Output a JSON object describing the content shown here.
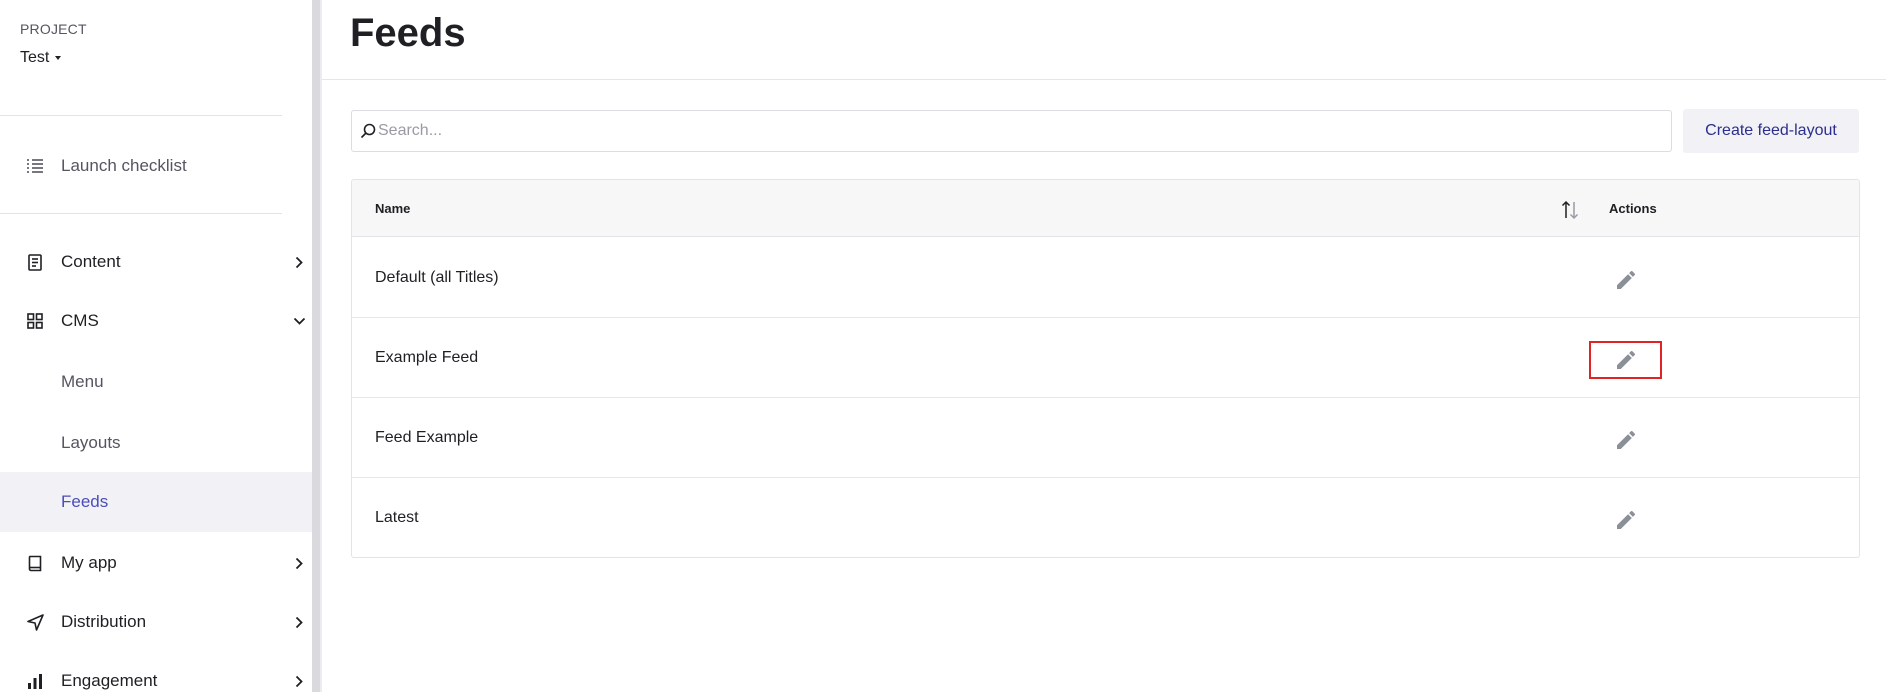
{
  "sidebar": {
    "project_label": "PROJECT",
    "project_name": "Test",
    "items": [
      {
        "label": "Launch checklist",
        "icon": "checklist-icon"
      },
      {
        "label": "Content",
        "icon": "document-icon"
      },
      {
        "label": "CMS",
        "icon": "grid-icon"
      },
      {
        "label": "Menu"
      },
      {
        "label": "Layouts"
      },
      {
        "label": "Feeds",
        "active": true
      },
      {
        "label": "My app",
        "icon": "book-icon"
      },
      {
        "label": "Distribution",
        "icon": "send-icon"
      },
      {
        "label": "Engagement",
        "icon": "bar-chart-icon"
      }
    ]
  },
  "main": {
    "title": "Feeds",
    "search": {
      "placeholder": "Search...",
      "value": ""
    },
    "create_button_label": "Create feed-layout",
    "table": {
      "columns": [
        "Name",
        "Actions"
      ],
      "rows": [
        {
          "name": "Default (all Titles)"
        },
        {
          "name": "Example Feed",
          "highlighted": true
        },
        {
          "name": "Feed Example"
        },
        {
          "name": "Latest"
        }
      ]
    }
  },
  "colors": {
    "accent": "#4b4db8",
    "button_text": "#2b2e8c",
    "highlight_box": "#e02424",
    "active_bg": "#f1f1f6"
  }
}
